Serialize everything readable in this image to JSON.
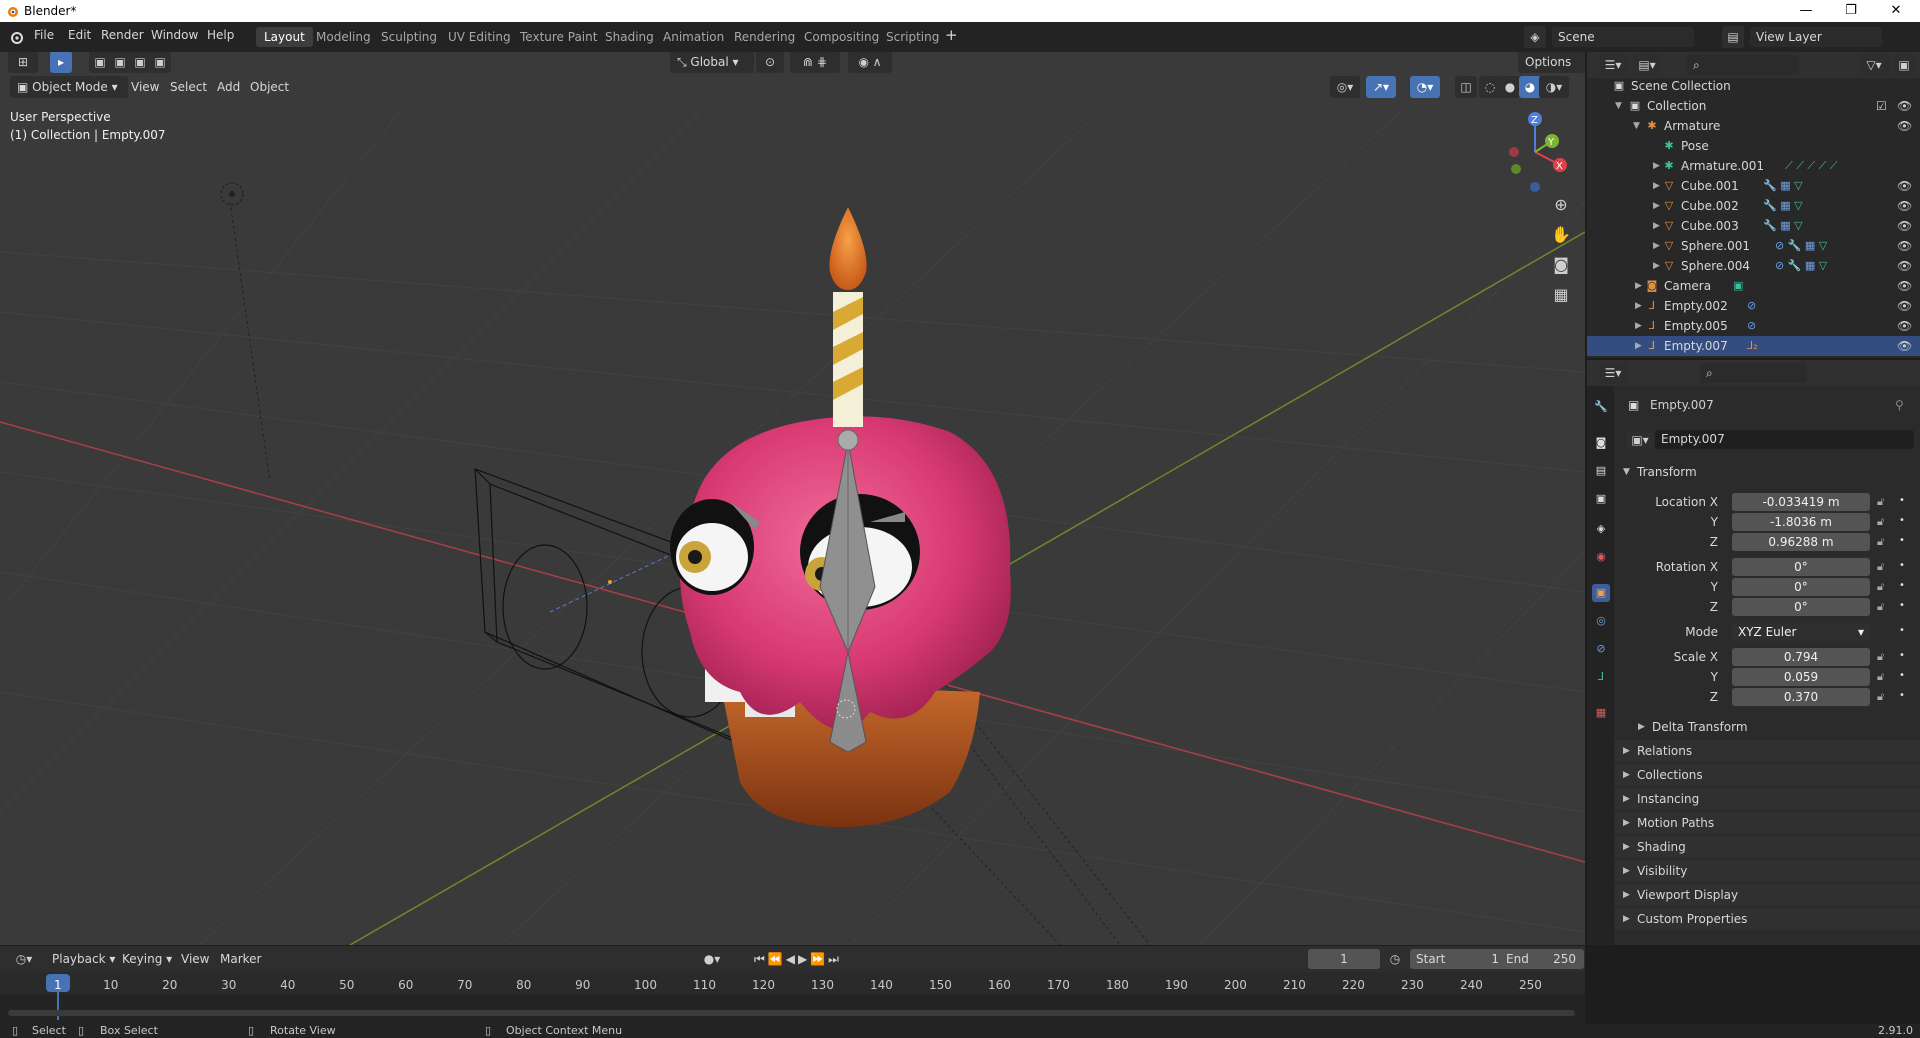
{
  "window": {
    "title": "Blender*",
    "minimize": "—",
    "maximize": "❐",
    "close": "✕"
  },
  "menu": [
    "File",
    "Edit",
    "Render",
    "Window",
    "Help"
  ],
  "workspaces": [
    "Layout",
    "Modeling",
    "Sculpting",
    "UV Editing",
    "Texture Paint",
    "Shading",
    "Animation",
    "Rendering",
    "Compositing",
    "Scripting"
  ],
  "active_workspace": "Layout",
  "scene": {
    "name": "Scene",
    "view_layer": "View Layer"
  },
  "viewport": {
    "transform_orientation": "Global",
    "options_label": "Options",
    "mode": "Object Mode",
    "menus": [
      "View",
      "Select",
      "Add",
      "Object"
    ],
    "perspective_label": "User Perspective",
    "context_label": "(1) Collection | Empty.007",
    "gizmo": {
      "x": "X",
      "y": "Y",
      "z": "Z"
    }
  },
  "outliner": {
    "rows": [
      {
        "label": "Scene Collection",
        "icon": "scene-collection-icon"
      },
      {
        "label": "Collection",
        "icon": "collection-icon"
      },
      {
        "label": "Armature",
        "icon": "armature-icon"
      },
      {
        "label": "Pose",
        "icon": "pose-icon"
      },
      {
        "label": "Armature.001",
        "icon": "armature-icon"
      },
      {
        "label": "Cube.001",
        "icon": "mesh-icon"
      },
      {
        "label": "Cube.002",
        "icon": "mesh-icon"
      },
      {
        "label": "Cube.003",
        "icon": "mesh-icon"
      },
      {
        "label": "Sphere.001",
        "icon": "mesh-icon"
      },
      {
        "label": "Sphere.004",
        "icon": "mesh-icon"
      },
      {
        "label": "Camera",
        "icon": "camera-icon"
      },
      {
        "label": "Empty.002",
        "icon": "empty-icon"
      },
      {
        "label": "Empty.005",
        "icon": "empty-icon"
      },
      {
        "label": "Empty.007",
        "icon": "empty-icon"
      }
    ]
  },
  "properties": {
    "object_name": "Empty.007",
    "datablock_name": "Empty.007",
    "transform_header": "Transform",
    "location": {
      "label": "Location X",
      "x": "-0.033419 m",
      "y": "-1.8036 m",
      "z": "0.96288 m"
    },
    "rotation": {
      "label": "Rotation X",
      "x": "0°",
      "y": "0°",
      "z": "0°"
    },
    "mode": {
      "label": "Mode",
      "value": "XYZ Euler"
    },
    "scale": {
      "label": "Scale X",
      "x": "0.794",
      "y": "0.059",
      "z": "0.370"
    },
    "axis_labels": {
      "y": "Y",
      "z": "Z"
    },
    "delta_transform": "Delta Transform",
    "panels": [
      "Relations",
      "Collections",
      "Instancing",
      "Motion Paths",
      "Shading",
      "Visibility",
      "Viewport Display",
      "Custom Properties"
    ]
  },
  "timeline": {
    "menus": [
      "Playback",
      "Keying",
      "View",
      "Marker"
    ],
    "current_frame": "1",
    "start_label": "Start",
    "start": "1",
    "end_label": "End",
    "end": "250",
    "ticks": [
      "1",
      "10",
      "20",
      "30",
      "40",
      "50",
      "60",
      "70",
      "80",
      "90",
      "100",
      "110",
      "120",
      "130",
      "140",
      "150",
      "160",
      "170",
      "180",
      "190",
      "200",
      "210",
      "220",
      "230",
      "240",
      "250"
    ]
  },
  "statusbar": {
    "select": "Select",
    "box_select": "Box Select",
    "rotate_view": "Rotate View",
    "context_menu": "Object Context Menu",
    "version": "2.91.0"
  },
  "colors": {
    "accent": "#4772b3",
    "active_row": "#334d80",
    "frosting": "#e0407a",
    "cake": "#b5561e",
    "candle_flame": "#e0792c"
  }
}
